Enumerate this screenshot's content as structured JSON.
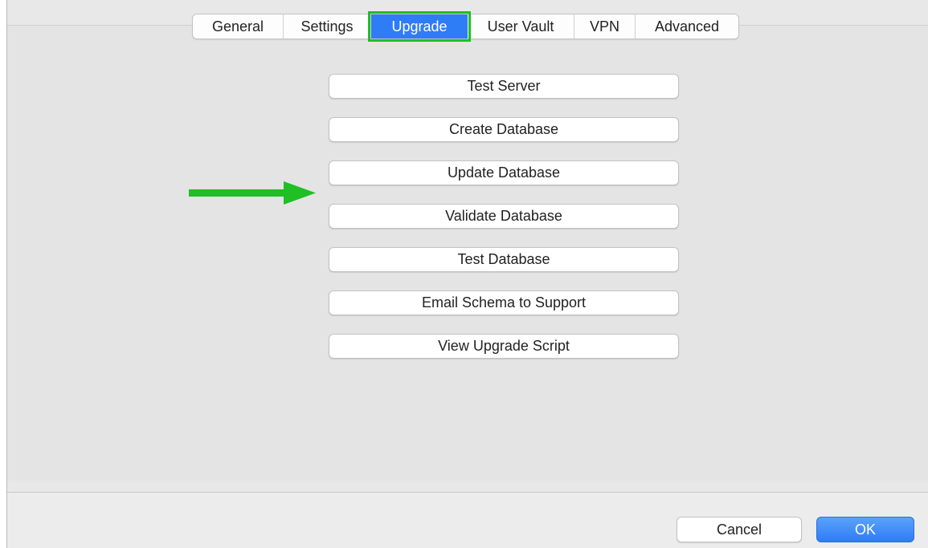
{
  "tabs": [
    {
      "label": "General",
      "selected": false
    },
    {
      "label": "Settings",
      "selected": false
    },
    {
      "label": "Upgrade",
      "selected": true
    },
    {
      "label": "User Vault",
      "selected": false
    },
    {
      "label": "VPN",
      "selected": false
    },
    {
      "label": "Advanced",
      "selected": false
    }
  ],
  "actions": [
    {
      "label": "Test Server"
    },
    {
      "label": "Create Database"
    },
    {
      "label": "Update Database"
    },
    {
      "label": "Validate Database"
    },
    {
      "label": "Test Database"
    },
    {
      "label": "Email Schema to Support"
    },
    {
      "label": "View Upgrade Script"
    }
  ],
  "footer": {
    "cancel_label": "Cancel",
    "ok_label": "OK"
  },
  "annotations": {
    "highlight_color": "#1fbf25",
    "arrow_color": "#1fbf25",
    "arrow_target": "Update Database",
    "highlighted_tab": "Upgrade"
  },
  "colors": {
    "accent": "#2e7cf6",
    "panel_bg": "#e4e4e4"
  }
}
